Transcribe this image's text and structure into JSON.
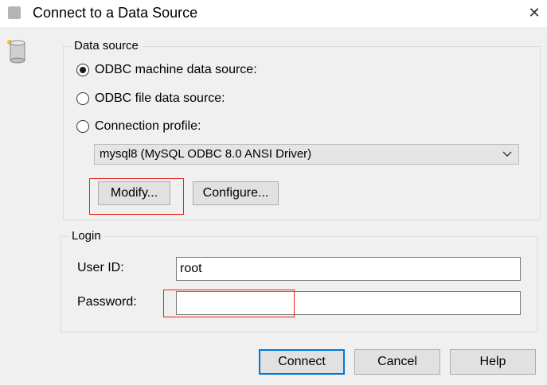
{
  "window": {
    "title": "Connect to a Data Source",
    "close_glyph": "✕"
  },
  "data_source": {
    "legend": "Data source",
    "options": [
      {
        "label": "ODBC machine data source:",
        "selected": true
      },
      {
        "label": "ODBC file data source:",
        "selected": false
      },
      {
        "label": "Connection profile:",
        "selected": false
      }
    ],
    "selected_source": "mysql8 (MySQL ODBC 8.0 ANSI Driver)",
    "modify_label": "Modify...",
    "configure_label": "Configure..."
  },
  "login": {
    "legend": "Login",
    "user_id_label": "User ID:",
    "user_id_value": "root",
    "password_label": "Password:",
    "password_value": ""
  },
  "buttons": {
    "connect": "Connect",
    "cancel": "Cancel",
    "help": "Help"
  },
  "colors": {
    "highlight": "#e8221c",
    "default_button_border": "#0078d7"
  },
  "icons": {
    "app": "database-icon",
    "dropdown": "chevron-down-icon"
  }
}
